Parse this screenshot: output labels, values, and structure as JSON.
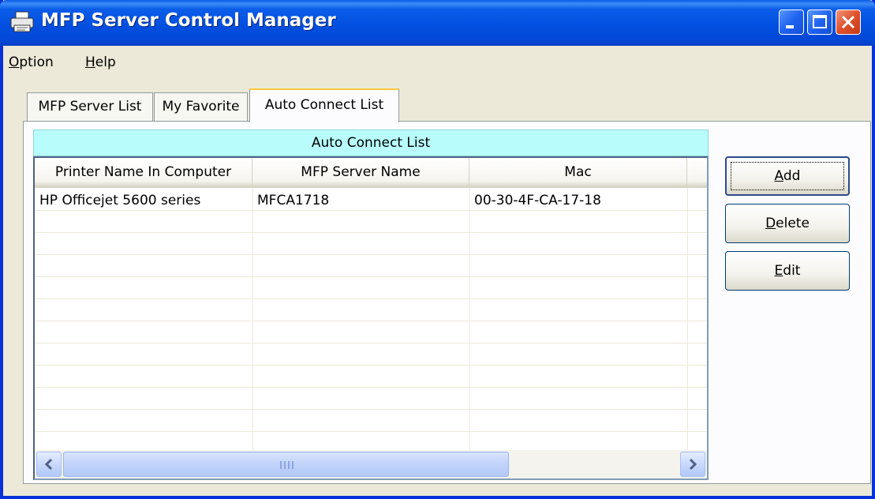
{
  "window": {
    "title": "MFP Server Control Manager",
    "accent_color": "#0350e0",
    "icon": "printer-icon"
  },
  "menu": {
    "option_mnemonic": "O",
    "option_rest": "ption",
    "help_mnemonic": "H",
    "help_rest": "elp"
  },
  "tabs": [
    {
      "label": "MFP Server List",
      "selected": false
    },
    {
      "label": "My Favorite",
      "selected": false
    },
    {
      "label": "Auto Connect List",
      "selected": true
    }
  ],
  "panel": {
    "header": "Auto Connect List",
    "header_color": "#b8fcfc"
  },
  "table": {
    "columns": [
      "Printer Name In Computer",
      "MFP Server Name",
      "Mac",
      ""
    ],
    "rows": [
      [
        "HP Officejet 5600 series",
        "MFCA1718",
        "00-30-4F-CA-17-18",
        ""
      ]
    ]
  },
  "buttons": {
    "add_mnemonic": "A",
    "add_rest": "dd",
    "delete_mnemonic": "D",
    "delete_rest": "elete",
    "edit_mnemonic": "E",
    "edit_rest": "dit"
  }
}
